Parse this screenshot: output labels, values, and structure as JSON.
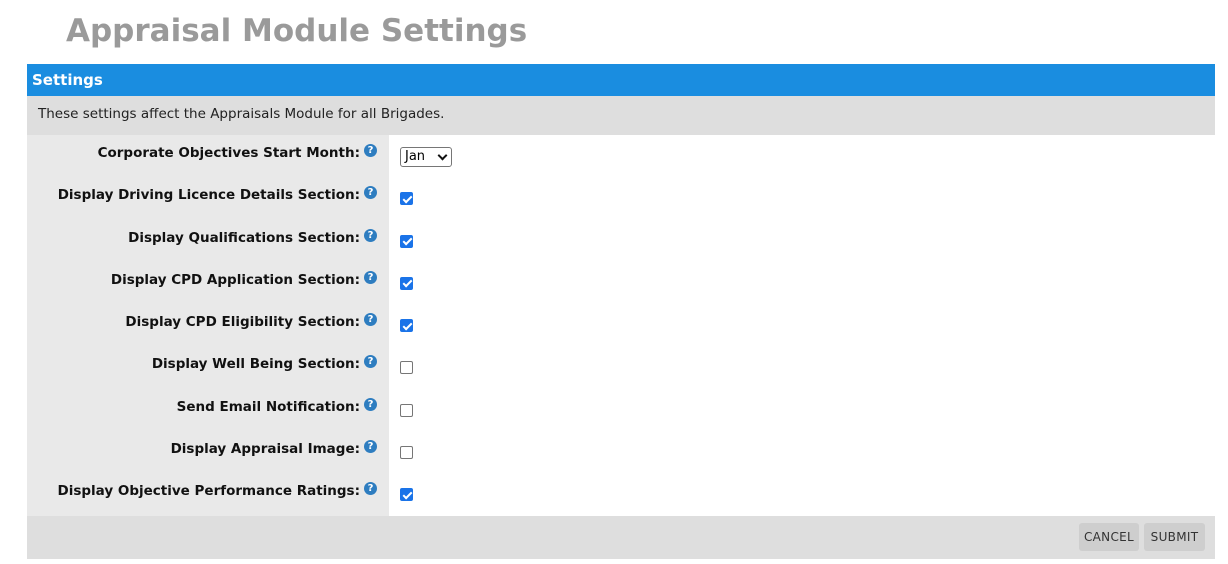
{
  "page": {
    "title": "Appraisal Module Settings"
  },
  "panel": {
    "header": "Settings",
    "description": "These settings affect the Appraisals Module for all Brigades."
  },
  "settings": [
    {
      "label": "Corporate Objectives Start Month:",
      "type": "select",
      "value": "Jan"
    },
    {
      "label": "Display Driving Licence Details Section:",
      "type": "checkbox",
      "checked": true
    },
    {
      "label": "Display Qualifications Section:",
      "type": "checkbox",
      "checked": true
    },
    {
      "label": "Display CPD Application Section:",
      "type": "checkbox",
      "checked": true
    },
    {
      "label": "Display CPD Eligibility Section:",
      "type": "checkbox",
      "checked": true
    },
    {
      "label": "Display Well Being Section:",
      "type": "checkbox",
      "checked": false
    },
    {
      "label": "Send Email Notification:",
      "type": "checkbox",
      "checked": false
    },
    {
      "label": "Display Appraisal Image:",
      "type": "checkbox",
      "checked": false
    },
    {
      "label": "Display Objective Performance Ratings:",
      "type": "checkbox",
      "checked": true
    }
  ],
  "help_icon": {
    "glyph": "?",
    "icon": "help-icon",
    "color": "#2e7dc0"
  },
  "buttons": {
    "cancel": "CANCEL",
    "submit": "SUBMIT"
  },
  "colors": {
    "header": "#1a8de0",
    "checkbox_checked": "#1a73e8",
    "title": "#9a9a9a"
  }
}
